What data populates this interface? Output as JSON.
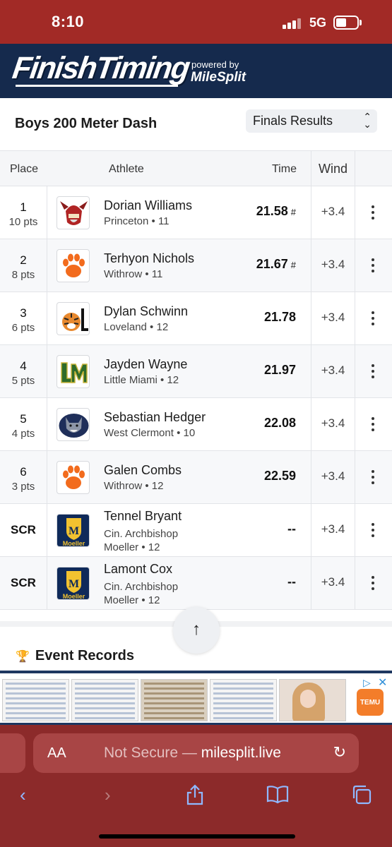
{
  "status_bar": {
    "time": "8:10",
    "network": "5G"
  },
  "brand": {
    "logo": "FinishTiming",
    "powered_by": "powered by",
    "partner": "MileSplit"
  },
  "event": {
    "title": "Boys 200 Meter Dash",
    "view_select": "Finals Results"
  },
  "table": {
    "headers": {
      "place": "Place",
      "athlete": "Athlete",
      "time": "Time",
      "wind": "Wind"
    },
    "rows": [
      {
        "place": "1",
        "points": "10 pts",
        "name": "Dorian Williams",
        "team": "Princeton • 11",
        "time": "21.58",
        "mark": "#",
        "wind": "+3.4",
        "logo": "viking-logo"
      },
      {
        "place": "2",
        "points": "8 pts",
        "name": "Terhyon Nichols",
        "team": "Withrow • 11",
        "time": "21.67",
        "mark": "#",
        "wind": "+3.4",
        "logo": "paw-logo"
      },
      {
        "place": "3",
        "points": "6 pts",
        "name": "Dylan Schwinn",
        "team": "Loveland • 12",
        "time": "21.78",
        "mark": "",
        "wind": "+3.4",
        "logo": "tiger-logo"
      },
      {
        "place": "4",
        "points": "5 pts",
        "name": "Jayden Wayne",
        "team": "Little Miami • 12",
        "time": "21.97",
        "mark": "",
        "wind": "+3.4",
        "logo": "lm-logo"
      },
      {
        "place": "5",
        "points": "4 pts",
        "name": "Sebastian Hedger",
        "team": "West Clermont • 10",
        "time": "22.08",
        "mark": "",
        "wind": "+3.4",
        "logo": "wolf-logo"
      },
      {
        "place": "6",
        "points": "3 pts",
        "name": "Galen Combs",
        "team": "Withrow • 12",
        "time": "22.59",
        "mark": "",
        "wind": "+3.4",
        "logo": "paw-logo"
      },
      {
        "place": "SCR",
        "points": "",
        "name": "Tennel Bryant",
        "team_line1": "Cin. Archbishop",
        "team_line2": "Moeller • 12",
        "time": "--",
        "mark": "",
        "wind": "+3.4",
        "logo": "moeller-logo"
      },
      {
        "place": "SCR",
        "points": "",
        "name": "Lamont Cox",
        "team_line1": "Cin. Archbishop",
        "team_line2": "Moeller • 12",
        "time": "--",
        "mark": "",
        "wind": "+3.4",
        "logo": "moeller-logo"
      }
    ]
  },
  "records": {
    "title": "Event Records"
  },
  "ad": {
    "brand": "TEMU"
  },
  "safari": {
    "aa": "AA",
    "not_secure": "Not Secure —",
    "domain": "milesplit.live"
  },
  "colors": {
    "status_red": "#a22a26",
    "navy": "#152a4d",
    "safari_red": "#8c2a2a"
  }
}
